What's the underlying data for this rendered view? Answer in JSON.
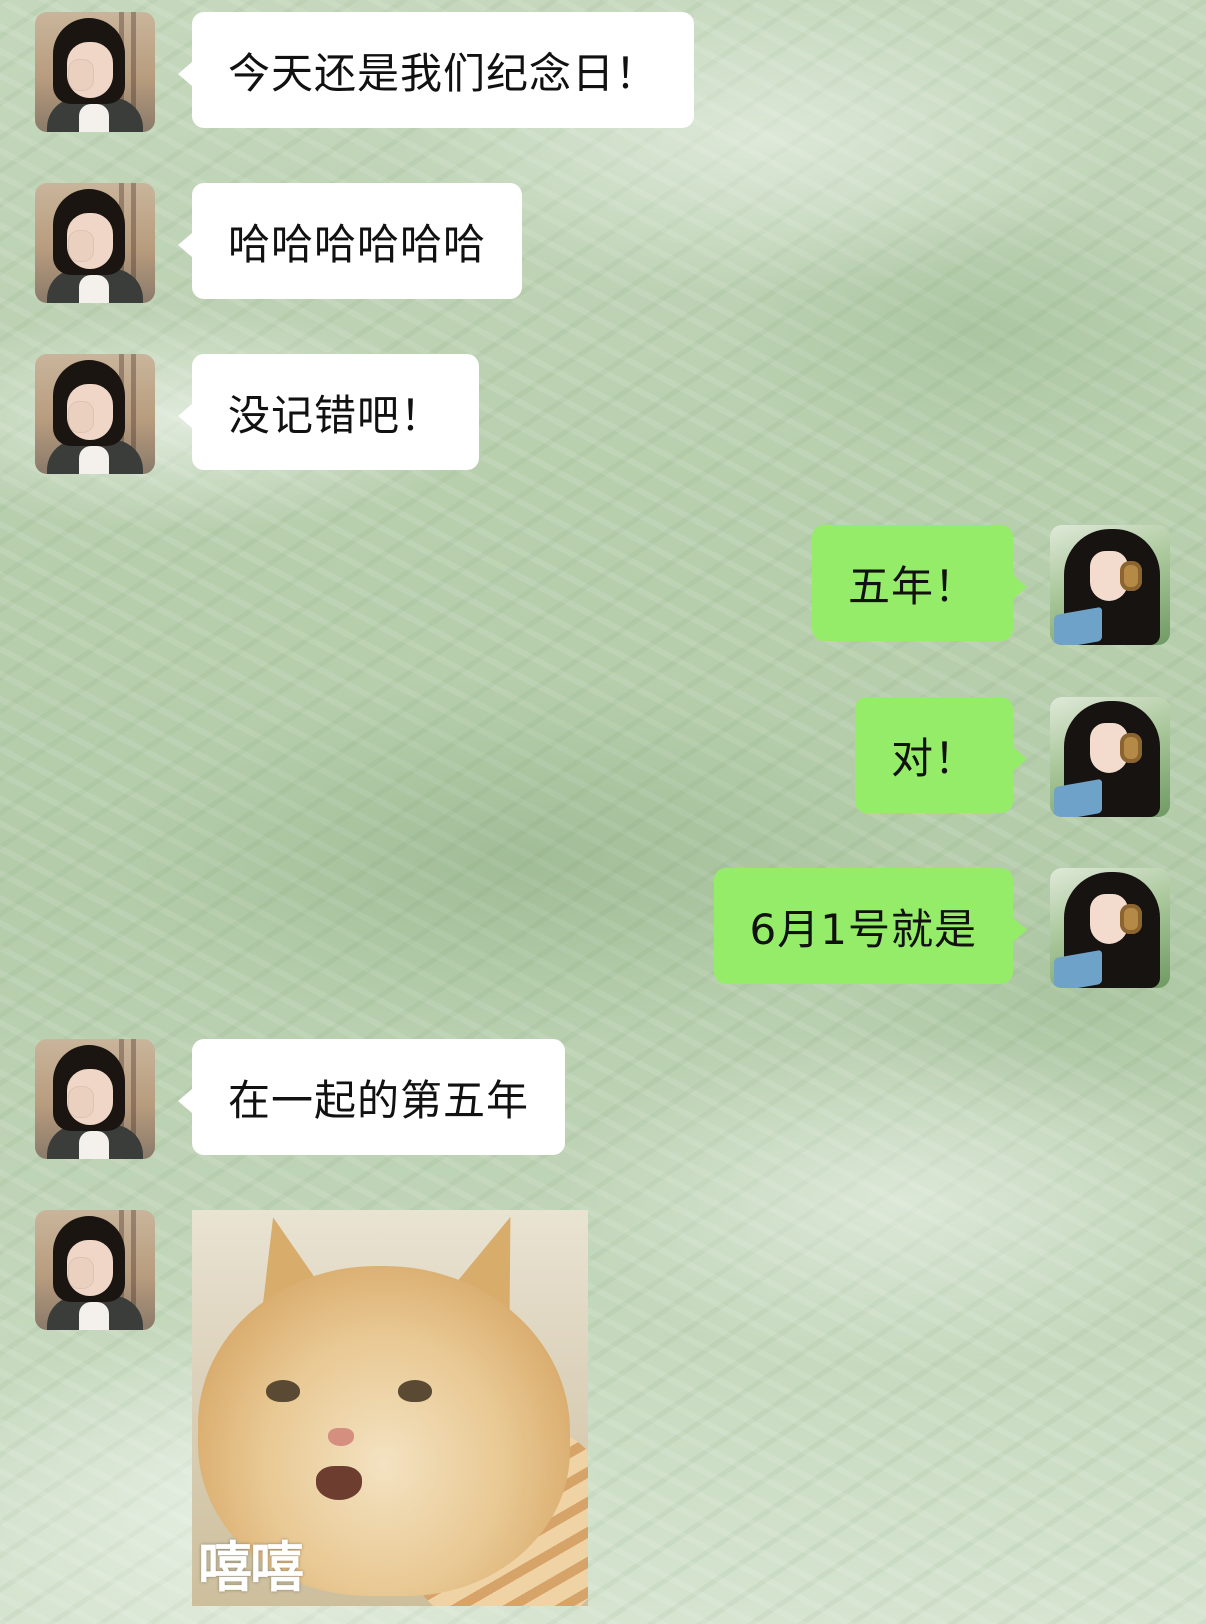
{
  "messages": [
    {
      "from": "other",
      "text": "今天还是我们纪念日！"
    },
    {
      "from": "other",
      "text": "哈哈哈哈哈哈"
    },
    {
      "from": "other",
      "text": "没记错吧！"
    },
    {
      "from": "me",
      "text": "五年！"
    },
    {
      "from": "me",
      "text": "对！"
    },
    {
      "from": "me",
      "text": "6月1号就是"
    },
    {
      "from": "other",
      "text": "在一起的第五年"
    },
    {
      "from": "other",
      "sticker": {
        "caption": "嘻嘻",
        "subject": "laughing-cat"
      }
    }
  ],
  "colors": {
    "incoming_bubble": "#ffffff",
    "outgoing_bubble": "#95ec69",
    "text": "#111111",
    "background": "#b8cfae"
  },
  "avatars": {
    "other": "avatar-girl-covering-eye",
    "me": "avatar-girl-with-headphones"
  }
}
